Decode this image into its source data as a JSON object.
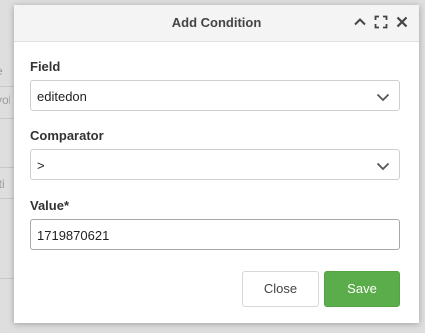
{
  "background": {
    "partial_texts": [
      "e",
      "volu",
      "iti"
    ]
  },
  "modal": {
    "title": "Add Condition",
    "header_icons": [
      "chevron-up-icon",
      "expand-icon",
      "close-icon"
    ],
    "fields": {
      "field": {
        "label": "Field",
        "value": "editedon"
      },
      "comparator": {
        "label": "Comparator",
        "value": ">"
      },
      "value": {
        "label": "Value*",
        "value": "1719870621"
      }
    },
    "buttons": {
      "close": "Close",
      "save": "Save"
    }
  },
  "colors": {
    "save_button": "#5aad4a",
    "header_bg": "#f4f4f4"
  }
}
